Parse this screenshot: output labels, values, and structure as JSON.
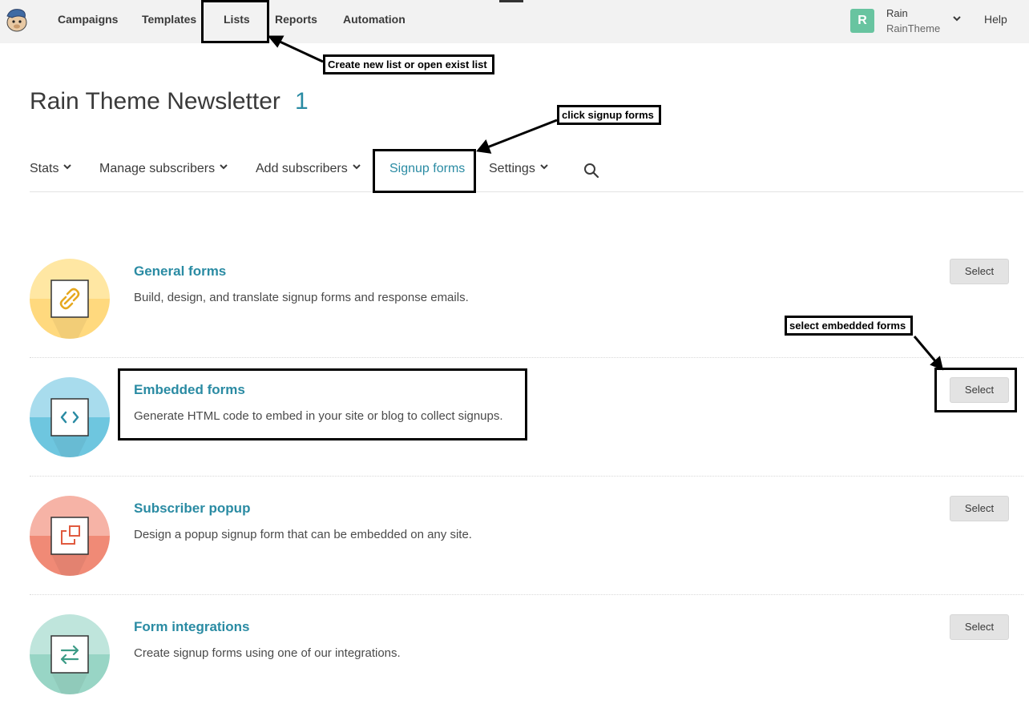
{
  "topnav": {
    "items": [
      "Campaigns",
      "Templates",
      "Lists",
      "Reports",
      "Automation"
    ],
    "user": {
      "initial": "R",
      "name": "Rain",
      "account": "RainTheme"
    },
    "help": "Help"
  },
  "page": {
    "title": "Rain Theme Newsletter",
    "count": "1"
  },
  "subnav": {
    "items": [
      {
        "label": "Stats",
        "dropdown": true
      },
      {
        "label": "Manage subscribers",
        "dropdown": true
      },
      {
        "label": "Add subscribers",
        "dropdown": true
      },
      {
        "label": "Signup forms",
        "active": true
      },
      {
        "label": "Settings",
        "dropdown": true
      }
    ]
  },
  "forms": [
    {
      "title": "General forms",
      "desc": "Build, design, and translate signup forms and response emails.",
      "button": "Select",
      "icon": "link-icon",
      "colors": {
        "light": "#ffe7a3",
        "dark": "#ffd97e",
        "glyph": "#e6a81f"
      }
    },
    {
      "title": "Embedded forms",
      "desc": "Generate HTML code to embed in your site or blog to collect signups.",
      "button": "Select",
      "icon": "code-icon",
      "colors": {
        "light": "#a8dced",
        "dark": "#6ec6df",
        "glyph": "#2a8ba3"
      }
    },
    {
      "title": "Subscriber popup",
      "desc": "Design a popup signup form that can be embedded on any site.",
      "button": "Select",
      "icon": "popup-icon",
      "colors": {
        "light": "#f6b3a6",
        "dark": "#f08a76",
        "glyph": "#e05a3f"
      }
    },
    {
      "title": "Form integrations",
      "desc": "Create signup forms using one of our integrations.",
      "button": "Select",
      "icon": "swap-arrows-icon",
      "colors": {
        "light": "#bfe5dc",
        "dark": "#98d5c5",
        "glyph": "#3c9b86"
      }
    }
  ],
  "annotations": {
    "lists": "Create new list or open exist list",
    "signup": "click signup forms",
    "embedded": "select embedded forms"
  }
}
